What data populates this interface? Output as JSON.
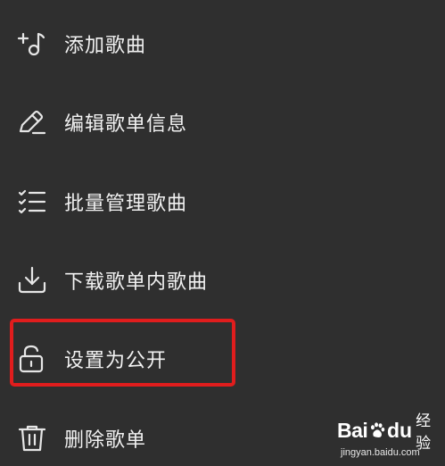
{
  "menu": {
    "items": [
      {
        "label": "添加歌曲",
        "icon": "add-music-icon"
      },
      {
        "label": "编辑歌单信息",
        "icon": "edit-pencil-icon"
      },
      {
        "label": "批量管理歌曲",
        "icon": "batch-list-icon"
      },
      {
        "label": "下载歌单内歌曲",
        "icon": "download-icon"
      },
      {
        "label": "设置为公开",
        "icon": "unlock-icon"
      },
      {
        "label": "删除歌单",
        "icon": "trash-icon"
      }
    ]
  },
  "highlight": {
    "color": "#e01d1d",
    "target": "设置为公开"
  },
  "watermark": {
    "brand_left": "Bai",
    "brand_right": "du",
    "product": "经验",
    "site": "jingyan.baidu.com"
  },
  "colors": {
    "background": "#2f2f2f",
    "text": "#f2f2f2",
    "icon": "#e6e6e6"
  }
}
